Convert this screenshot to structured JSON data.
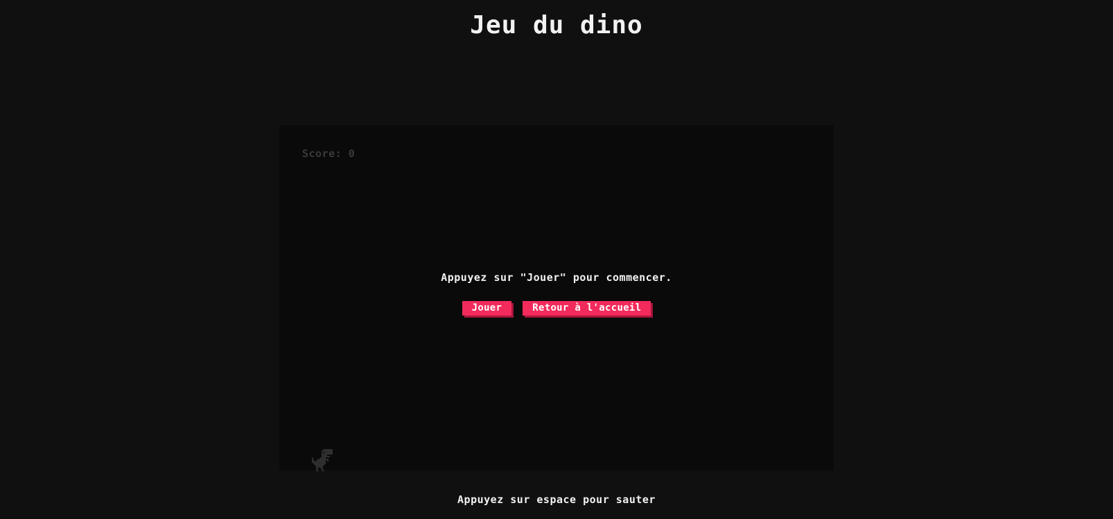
{
  "page": {
    "title": "Jeu du dino"
  },
  "game": {
    "score_label": "Score:",
    "score_value": "0",
    "start_prompt": "Appuyez sur \"Jouer\" pour commencer.",
    "play_button": "Jouer",
    "home_button": "Retour à l'accueil",
    "character_icon": "dino-icon"
  },
  "footer": {
    "hint": "Appuyez sur espace pour sauter"
  },
  "colors": {
    "background": "#101010",
    "game_area": "#0a0a0a",
    "accent": "#f22b5c",
    "accent_shadow": "#a8153c",
    "text": "#f2f2f2",
    "score_text": "#3a3a3a",
    "dino": "#2e2e2e"
  }
}
